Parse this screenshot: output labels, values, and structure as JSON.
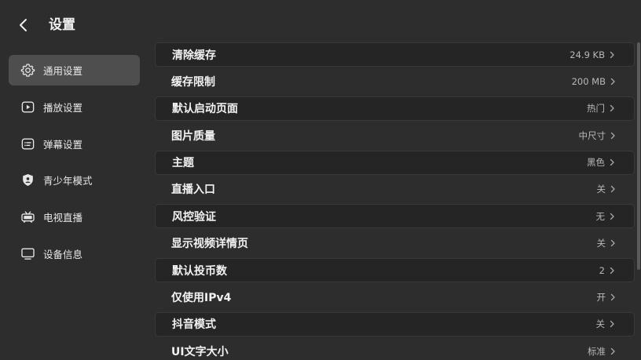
{
  "header": {
    "title": "设置",
    "back_icon": "chevron-left-icon"
  },
  "sidebar": {
    "items": [
      {
        "label": "通用设置",
        "icon": "gear-icon",
        "active": true
      },
      {
        "label": "播放设置",
        "icon": "play-icon",
        "active": false
      },
      {
        "label": "弹幕设置",
        "icon": "danmaku-icon",
        "active": false
      },
      {
        "label": "青少年模式",
        "icon": "shield-icon",
        "active": false
      },
      {
        "label": "电视直播",
        "icon": "tv-live-icon",
        "active": false
      },
      {
        "label": "设备信息",
        "icon": "monitor-icon",
        "active": false
      }
    ]
  },
  "settings": {
    "rows": [
      {
        "label": "清除缓存",
        "value": "24.9 KB"
      },
      {
        "label": "缓存限制",
        "value": "200 MB"
      },
      {
        "label": "默认启动页面",
        "value": "热门"
      },
      {
        "label": "图片质量",
        "value": "中尺寸"
      },
      {
        "label": "主题",
        "value": "黑色"
      },
      {
        "label": "直播入口",
        "value": "关"
      },
      {
        "label": "风控验证",
        "value": "无"
      },
      {
        "label": "显示视频详情页",
        "value": "关"
      },
      {
        "label": "默认投币数",
        "value": "2"
      },
      {
        "label": "仅使用IPv4",
        "value": "开"
      },
      {
        "label": "抖音模式",
        "value": "关"
      },
      {
        "label": "UI文字大小",
        "value": "标准"
      }
    ]
  },
  "colors": {
    "background": "#2d2d2d",
    "active_item": "#4e4e4e",
    "card": "#252525"
  }
}
